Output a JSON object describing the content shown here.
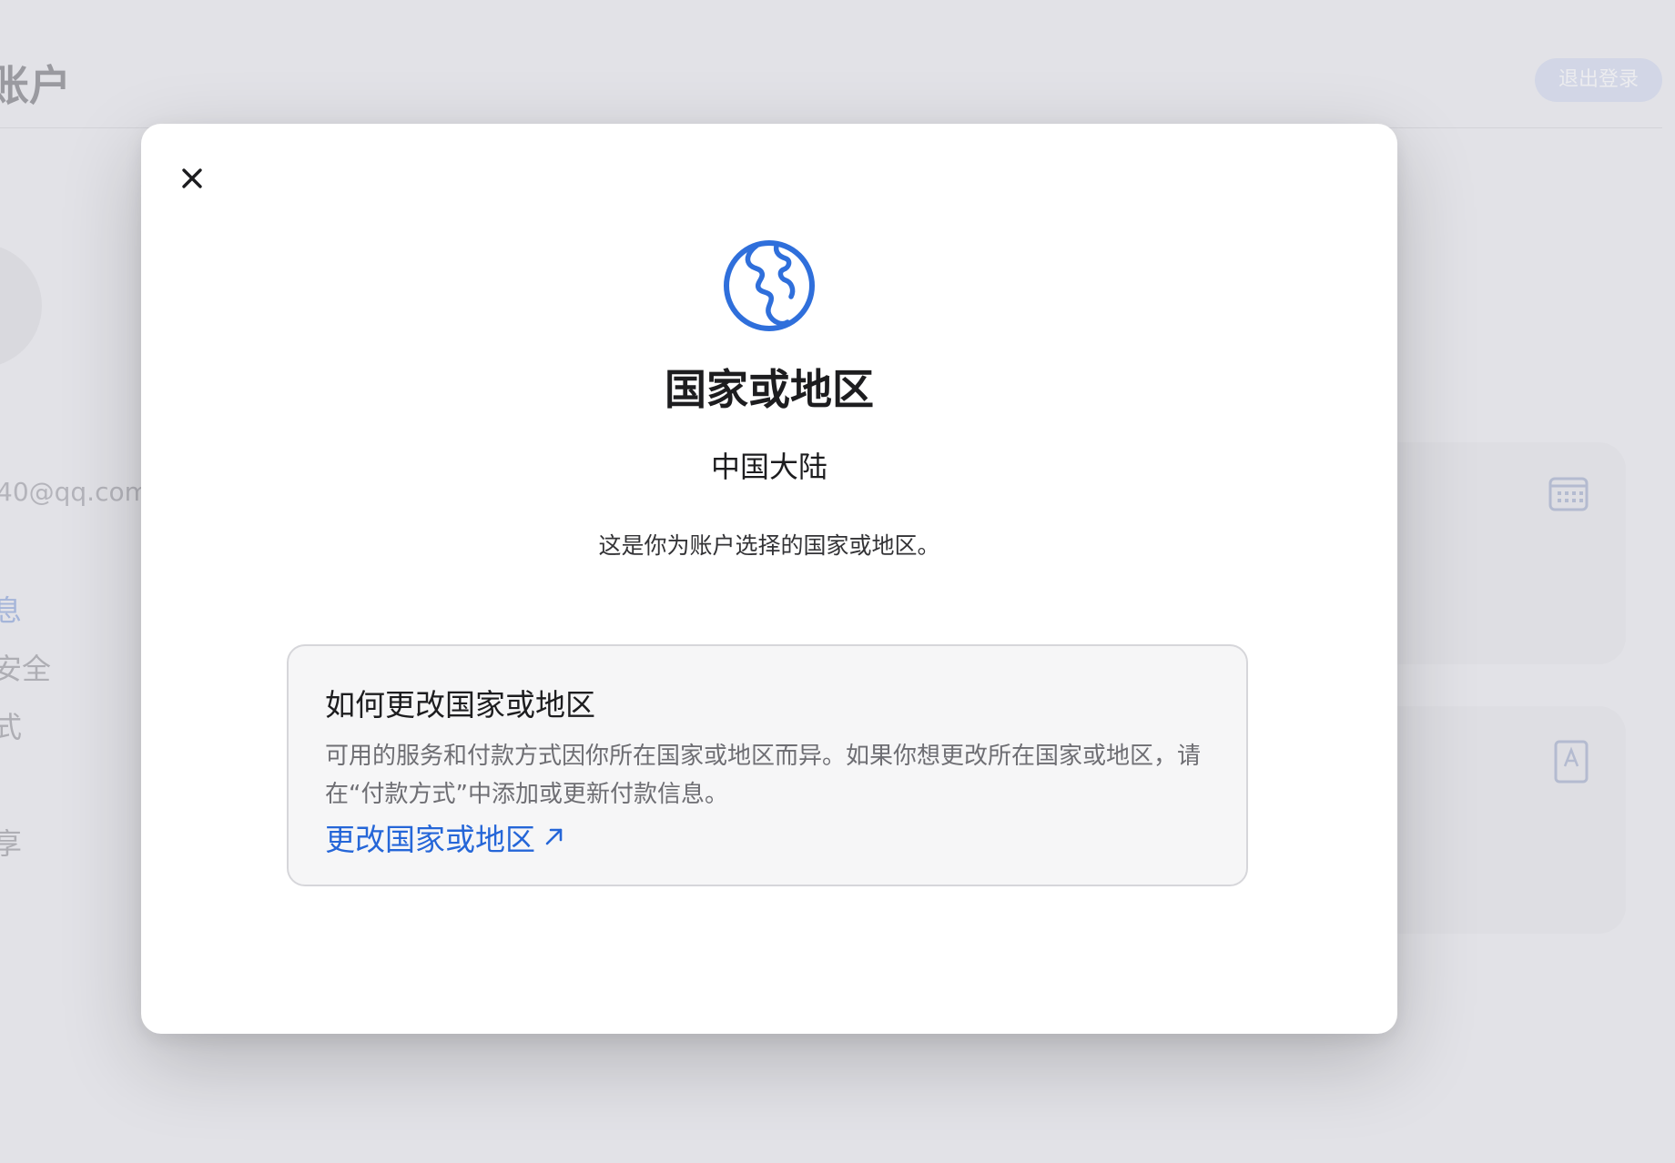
{
  "background": {
    "page_title": "账户",
    "sign_out_button": "退出登录",
    "email_fragment": "40@qq.com",
    "sidebar_fragments": [
      "息",
      "安全",
      "式",
      "享"
    ]
  },
  "modal": {
    "close_icon": "close-icon",
    "globe_icon": "globe-icon",
    "title": "国家或地区",
    "region": "中国大陆",
    "description": "这是你为账户选择的国家或地区。",
    "info_box": {
      "title": "如何更改国家或地区",
      "body": "可用的服务和付款方式因你所在国家或地区而异。如果你想更改所在国家或地区，请在“付款方式”中添加或更新付款信息。",
      "link_label": "更改国家或地区",
      "link_icon": "external-arrow-icon"
    }
  },
  "colors": {
    "accent": "#2566d8",
    "globe": "#2f6fdb",
    "title_text": "#1d1d1f",
    "muted_text": "#6e6e73"
  }
}
